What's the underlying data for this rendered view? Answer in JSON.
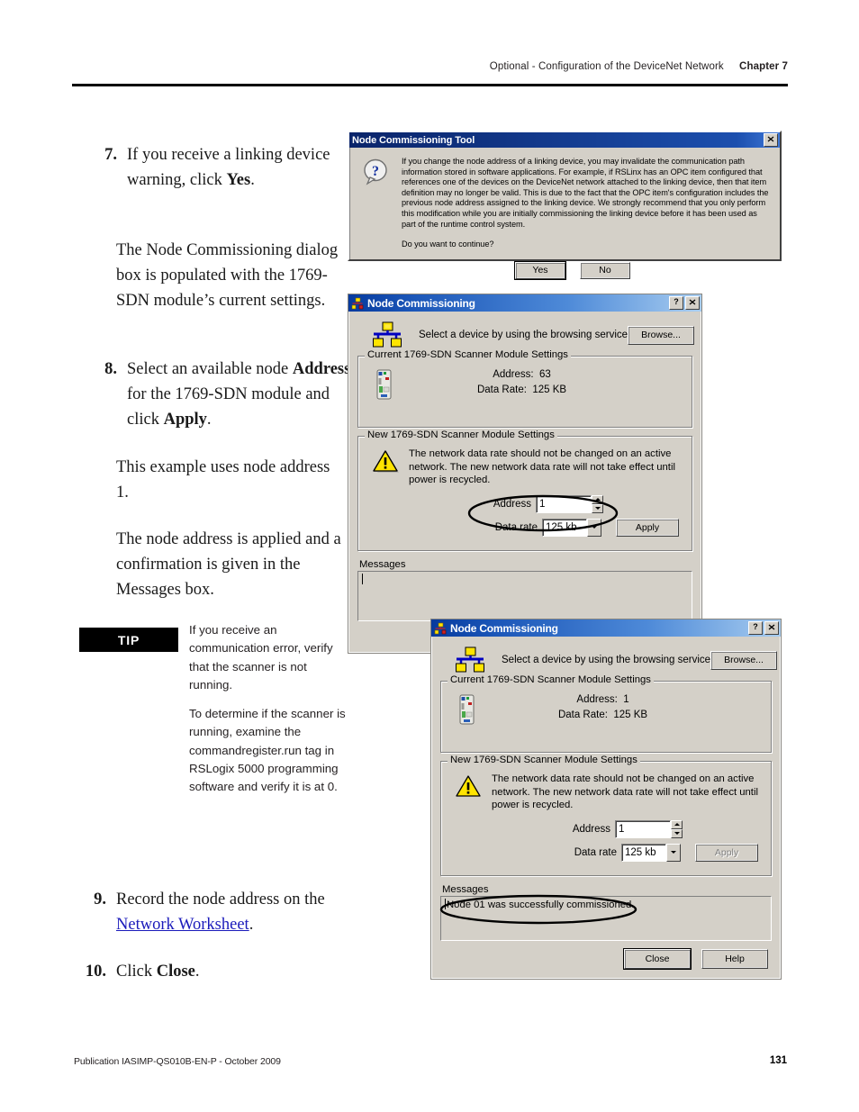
{
  "header": {
    "title": "Optional - Configuration of the DeviceNet Network",
    "chapter": "Chapter 7"
  },
  "footer": {
    "publication": "Publication IASIMP-QS010B-EN-P - October 2009",
    "page_number": "131"
  },
  "steps": {
    "step7": {
      "number": "7.",
      "text_a": "If you receive a linking device warning, click ",
      "bold_a": "Yes",
      "text_b": "."
    },
    "step7_note": "The Node Commissioning dialog box is populated with the 1769-SDN module’s current settings.",
    "step8": {
      "number": "8.",
      "text_a": "Select an available node ",
      "bold_a": "Address",
      "text_b": " for the 1769-SDN module and click ",
      "bold_b": "Apply",
      "text_c": "."
    },
    "step8_note1": "This example uses node address 1.",
    "step8_note2": "The node address is applied and a confirmation is given in the Messages box.",
    "step9": {
      "number": "9.",
      "text_a": "Record the node address on the ",
      "link": "Network Worksheet",
      "text_b": "."
    },
    "step10": {
      "number": "10.",
      "text_a": "Click ",
      "bold_a": "Close",
      "text_b": "."
    }
  },
  "tip": {
    "label": "TIP",
    "paragraph1": "If you receive an communication error, verify that the scanner is not running.",
    "paragraph2": "To determine if the scanner is running, examine the commandregister.run tag in RSLogix 5000 programming software and verify it is at 0."
  },
  "dialog_warning": {
    "title": "Node Commissioning Tool",
    "close_label": "✕",
    "icon": "question-icon",
    "body": "If you change the node address of a linking device, you may invalidate the communication path information stored in software applications. For example, if RSLinx has an OPC item configured that references one of the devices on the DeviceNet network attached to the linking device, then that item definition may no longer be valid. This is due to the fact that the OPC item's configuration includes the previous node address assigned to the linking device. We strongly recommend that you only perform this modification while you are initially commissioning the linking device before it has been used as part of the runtime control system.",
    "question": "Do you want to continue?",
    "yes_label": "Yes",
    "no_label": "No"
  },
  "dialog_before": {
    "title": "Node Commissioning",
    "help_label": "?",
    "close_label": "✕",
    "browse_prompt": "Select a device by using the browsing service",
    "browse_label": "Browse...",
    "current_group": "Current 1769-SDN Scanner Module Settings",
    "current_address_label": "Address:",
    "current_address_value": "63",
    "current_rate_label": "Data Rate:",
    "current_rate_value": "125 KB",
    "new_group": "New 1769-SDN Scanner Module Settings",
    "warning_text": "The network data rate should not be changed on an active network. The new network data rate will not take effect until power is recycled.",
    "address_label": "Address",
    "address_value": "1",
    "rate_label": "Data rate",
    "rate_value": "125 kb",
    "apply_label": "Apply",
    "messages_label": "Messages",
    "messages_value": ""
  },
  "dialog_after": {
    "title": "Node Commissioning",
    "help_label": "?",
    "close_label": "✕",
    "browse_prompt": "Select a device by using the browsing service",
    "browse_label": "Browse...",
    "current_group": "Current 1769-SDN Scanner Module Settings",
    "current_address_label": "Address:",
    "current_address_value": "1",
    "current_rate_label": "Data Rate:",
    "current_rate_value": "125 KB",
    "new_group": "New 1769-SDN Scanner Module Settings",
    "warning_text": "The network data rate should not be changed on an active network. The new network data rate will not take effect until power is recycled.",
    "address_label": "Address",
    "address_value": "1",
    "rate_label": "Data rate",
    "rate_value": "125 kb",
    "apply_label": "Apply",
    "messages_label": "Messages",
    "messages_value": "Node 01 was successfully commissioned.",
    "close_button_label": "Close",
    "help_button_label": "Help"
  },
  "colors": {
    "dialog_face": "#d4d0c8",
    "titlebar_blue": "#0a246a",
    "link_blue": "#1b1bbb",
    "warning_yellow": "#ffe400",
    "icon_yellow": "#ffe400",
    "icon_blue": "#0000c0"
  }
}
